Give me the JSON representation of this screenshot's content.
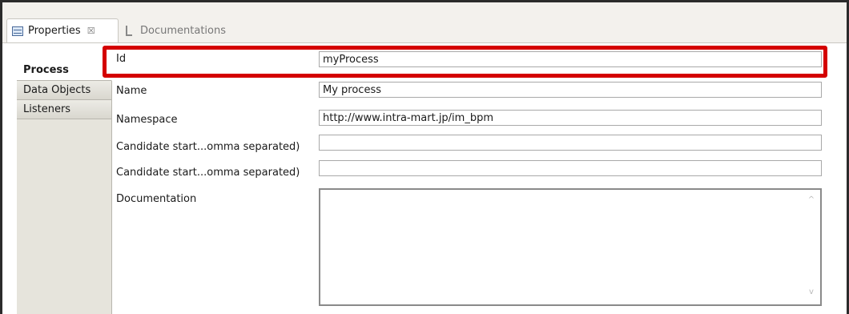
{
  "tabs": {
    "properties": "Properties",
    "properties_close": "☒",
    "documentations": "Documentations"
  },
  "categories": [
    "Process",
    "Data Objects",
    "Listeners"
  ],
  "form": {
    "id_label": "Id",
    "id_value": "myProcess",
    "name_label": "Name",
    "name_value": "My process",
    "namespace_label": "Namespace",
    "namespace_value": "http://www.intra-mart.jp/im_bpm",
    "candidate1_label": "Candidate start...omma separated)",
    "candidate1_value": "",
    "candidate2_label": "Candidate start...omma separated)",
    "candidate2_value": "",
    "documentation_label": "Documentation",
    "documentation_value": ""
  },
  "scroll": {
    "up": "^",
    "down": "v"
  },
  "colors": {
    "highlight": "#d40000"
  }
}
